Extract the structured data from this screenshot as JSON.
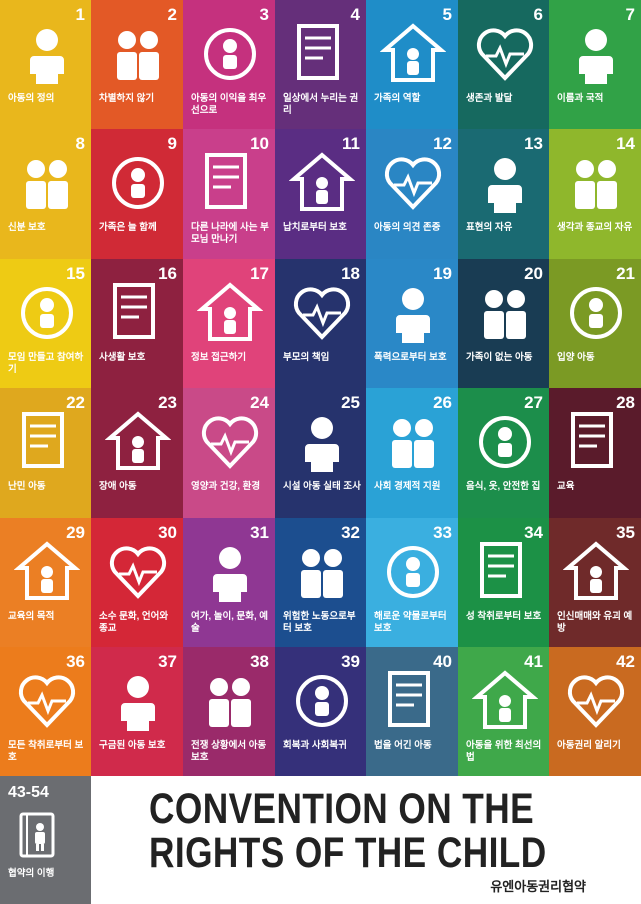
{
  "tiles": [
    {
      "num": "1",
      "label": "아동의 정의",
      "color": "#e9b71c",
      "icon": "child-under-18-icon"
    },
    {
      "num": "2",
      "label": "차별하지 않기",
      "color": "#e35926",
      "icon": "two-children-icon"
    },
    {
      "num": "3",
      "label": "아동의 이익을 최우선으로",
      "color": "#c5317e",
      "icon": "child-on-podium-icon"
    },
    {
      "num": "4",
      "label": "일상에서 누리는 권리",
      "color": "#652f7a",
      "icon": "certificate-icon"
    },
    {
      "num": "5",
      "label": "가족의 역할",
      "color": "#1f8dc8",
      "icon": "family-house-icon"
    },
    {
      "num": "6",
      "label": "생존과 발달",
      "color": "#16695f",
      "icon": "heartbeat-icon"
    },
    {
      "num": "7",
      "label": "이름과 국적",
      "color": "#31a247",
      "icon": "flag-icon"
    },
    {
      "num": "8",
      "label": "신분 보호",
      "color": "#e9b71c",
      "icon": "id-card-icon"
    },
    {
      "num": "9",
      "label": "가족은 늘 함께",
      "color": "#d02a36",
      "icon": "family-heart-icon"
    },
    {
      "num": "10",
      "label": "다른 나라에 사는 부모님 만나기",
      "color": "#c93f8b",
      "icon": "globe-family-icon"
    },
    {
      "num": "11",
      "label": "납치로부터 보호",
      "color": "#5a2d83",
      "icon": "abduction-protection-icon"
    },
    {
      "num": "12",
      "label": "아동의 의견 존중",
      "color": "#2a86c4",
      "icon": "speech-bubble-icon"
    },
    {
      "num": "13",
      "label": "표현의 자유",
      "color": "#1a6a72",
      "icon": "megaphone-icon"
    },
    {
      "num": "14",
      "label": "생각과 종교의 자유",
      "color": "#8fb72c",
      "icon": "thought-bubble-icon"
    },
    {
      "num": "15",
      "label": "모임 만들고 참여하기",
      "color": "#eecb14",
      "icon": "protest-sign-icon"
    },
    {
      "num": "16",
      "label": "사생활 보호",
      "color": "#8e2140",
      "icon": "keyhole-icon"
    },
    {
      "num": "17",
      "label": "정보 접근하기",
      "color": "#e0437a",
      "icon": "satellite-icon"
    },
    {
      "num": "18",
      "label": "부모의 책임",
      "color": "#26336d",
      "icon": "hands-family-icon"
    },
    {
      "num": "19",
      "label": "폭력으로부터 보호",
      "color": "#2a88c7",
      "icon": "shield-child-icon"
    },
    {
      "num": "20",
      "label": "가족이 없는 아동",
      "color": "#193c53",
      "icon": "children-circle-icon"
    },
    {
      "num": "21",
      "label": "입양 아동",
      "color": "#7b9a24",
      "icon": "adoption-heart-icon"
    },
    {
      "num": "22",
      "label": "난민 아동",
      "color": "#dfa81e",
      "icon": "running-child-icon"
    },
    {
      "num": "23",
      "label": "장애 아동",
      "color": "#8e2140",
      "icon": "wheelchair-icon"
    },
    {
      "num": "24",
      "label": "영양과 건강, 환경",
      "color": "#c94a88",
      "icon": "health-checks-icon"
    },
    {
      "num": "25",
      "label": "시설 아동 실태 조사",
      "color": "#26336d",
      "icon": "checklist-icon"
    },
    {
      "num": "26",
      "label": "사회 경제적 지원",
      "color": "#2aa2d6",
      "icon": "hands-support-icon"
    },
    {
      "num": "27",
      "label": "음식, 옷, 안전한 집",
      "color": "#1c8e4b",
      "icon": "basic-needs-icon"
    },
    {
      "num": "28",
      "label": "교육",
      "color": "#5a1b2b",
      "icon": "books-icon"
    },
    {
      "num": "29",
      "label": "교육의 목적",
      "color": "#eb7f24",
      "icon": "education-head-icon"
    },
    {
      "num": "30",
      "label": "소수 문화, 언어와 종교",
      "color": "#d42737",
      "icon": "minority-culture-icon"
    },
    {
      "num": "31",
      "label": "여가, 놀이, 문화, 예술",
      "color": "#8f3793",
      "icon": "play-music-icon"
    },
    {
      "num": "32",
      "label": "위험한 노동으로부터 보호",
      "color": "#1c4e8f",
      "icon": "shovel-icon"
    },
    {
      "num": "33",
      "label": "해로운 약물로부터 보호",
      "color": "#3aafe0",
      "icon": "no-drugs-icon"
    },
    {
      "num": "34",
      "label": "성 착취로부터 보호",
      "color": "#1c9146",
      "icon": "stop-hand-icon"
    },
    {
      "num": "35",
      "label": "인신매매와 유괴 예방",
      "color": "#6f2a2a",
      "icon": "price-tag-icon"
    },
    {
      "num": "36",
      "label": "모든 착취로부터 보호",
      "color": "#ec7c1c",
      "icon": "shield-badge-icon"
    },
    {
      "num": "37",
      "label": "구금된 아동 보호",
      "color": "#d02a4b",
      "icon": "prison-bars-icon"
    },
    {
      "num": "38",
      "label": "전쟁 상황에서 아동 보호",
      "color": "#9a2a6a",
      "icon": "crosshair-icon"
    },
    {
      "num": "39",
      "label": "회복과 사회복귀",
      "color": "#35307a",
      "icon": "bandage-icon"
    },
    {
      "num": "40",
      "label": "법을 어긴 아동",
      "color": "#3a6a8a",
      "icon": "scales-icon"
    },
    {
      "num": "41",
      "label": "아동을 위한 최선의 법",
      "color": "#3fa84a",
      "icon": "winner-podium-icon"
    },
    {
      "num": "42",
      "label": "아동권리 알리기",
      "color": "#c96a20",
      "icon": "globe-crowd-icon"
    }
  ],
  "footer_tile": {
    "num": "43-54",
    "label": "협약의 이행",
    "color": "#6b6d71",
    "icon": "book-child-icon"
  },
  "banner": {
    "title_line1": "CONVENTION ON THE",
    "title_line2": "RIGHTS OF THE CHILD",
    "subtitle": "유엔아동권리협약"
  }
}
